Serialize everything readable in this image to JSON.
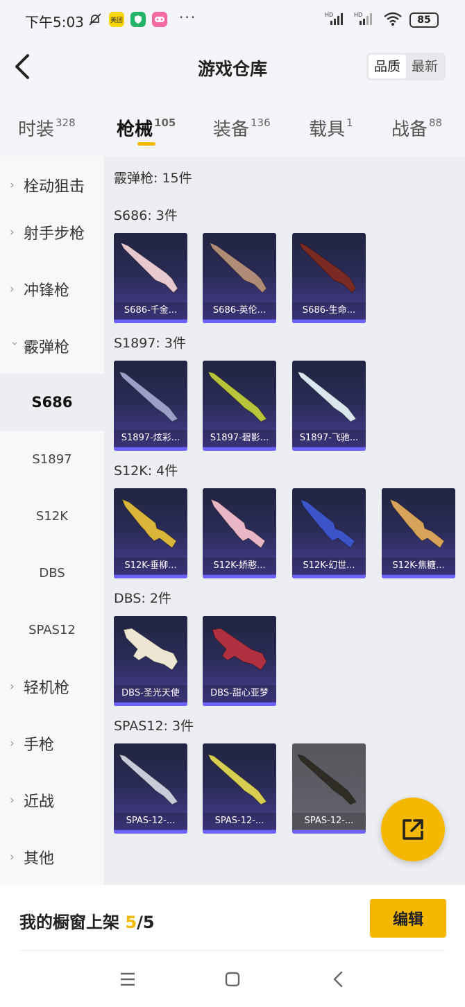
{
  "status_bar": {
    "time": "下午5:03",
    "app_icons": [
      "mute-bell-icon",
      "meituan-icon",
      "shield-app-icon",
      "game-app-icon"
    ],
    "more": "···",
    "battery": "85",
    "signal_labels": [
      "HD",
      "HD"
    ]
  },
  "header": {
    "title": "游戏仓库",
    "sort_options": [
      "品质",
      "最新"
    ],
    "active_sort": "品质"
  },
  "tabs": [
    {
      "label": "时装",
      "count": "328"
    },
    {
      "label": "枪械",
      "count": "105"
    },
    {
      "label": "装备",
      "count": "136"
    },
    {
      "label": "载具",
      "count": "1"
    },
    {
      "label": "战备",
      "count": "88"
    }
  ],
  "active_tab": "枪械",
  "sidebar": {
    "categories_top": [
      "栓动狙击",
      "射手步枪",
      "冲锋枪"
    ],
    "expanded": "霰弹枪",
    "subitems": [
      "S686",
      "S1897",
      "S12K",
      "DBS",
      "SPAS12"
    ],
    "active_subitem": "S686",
    "categories_bottom": [
      "轻机枪",
      "手枪",
      "近战",
      "其他"
    ]
  },
  "content": {
    "summary": "霰弹枪: 15件",
    "groups": [
      {
        "title": "S686: 3件",
        "items": [
          {
            "label": "S686-千金...",
            "color": "#e8c9cf",
            "kind": "double"
          },
          {
            "label": "S686-英伦...",
            "color": "#b08b78",
            "kind": "double"
          },
          {
            "label": "S686-生命...",
            "color": "#7a2a22",
            "kind": "double"
          }
        ]
      },
      {
        "title": "S1897: 3件",
        "items": [
          {
            "label": "S1897-炫彩...",
            "color": "#9aa0c8",
            "kind": "pump"
          },
          {
            "label": "S1897-碧影...",
            "color": "#b8c43a",
            "kind": "pump"
          },
          {
            "label": "S1897-飞驰...",
            "color": "#d9e6ee",
            "kind": "pump"
          }
        ]
      },
      {
        "title": "S12K: 4件",
        "items": [
          {
            "label": "S12K-垂柳...",
            "color": "#d9b63a",
            "kind": "rifle"
          },
          {
            "label": "S12K-娇憨...",
            "color": "#e8b6c4",
            "kind": "rifle"
          },
          {
            "label": "S12K-幻世...",
            "color": "#3b55c9",
            "kind": "rifle"
          },
          {
            "label": "S12K-焦糖...",
            "color": "#d7a35a",
            "kind": "rifle"
          }
        ]
      },
      {
        "title": "DBS: 2件",
        "items": [
          {
            "label": "DBS-圣光天使",
            "color": "#ece6d2",
            "kind": "bullpup"
          },
          {
            "label": "DBS-甜心亚梦",
            "color": "#b03040",
            "kind": "bullpup"
          }
        ]
      },
      {
        "title": "SPAS12: 3件",
        "items": [
          {
            "label": "SPAS-12-...",
            "color": "#c9ccd8",
            "kind": "pump",
            "dim": false
          },
          {
            "label": "SPAS-12-...",
            "color": "#d8cf52",
            "kind": "pump",
            "dim": false
          },
          {
            "label": "SPAS-12-...",
            "color": "#2e2c24",
            "kind": "pump",
            "dim": true
          }
        ]
      }
    ]
  },
  "fab_icon": "share-external-icon",
  "footer": {
    "label": "我的橱窗上架",
    "current": "5",
    "total": "/5",
    "edit_button": "编辑"
  },
  "navbar": [
    "menu-icon",
    "home-square-icon",
    "back-chevron-icon"
  ]
}
